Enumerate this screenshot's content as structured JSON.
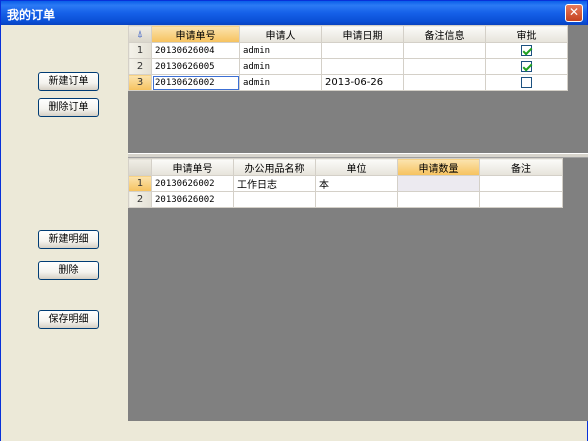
{
  "window": {
    "title": "我的订单",
    "close_symbol": "✕"
  },
  "buttons": {
    "new_order": "新建订单",
    "delete_order": "删除订单",
    "new_detail": "新建明细",
    "delete": "删除",
    "save_detail": "保存明细"
  },
  "orders": {
    "corner_symbol": "⍋",
    "columns": [
      "申请单号",
      "申请人",
      "申请日期",
      "备注信息",
      "审批"
    ],
    "rows": [
      {
        "num": "1",
        "id": "20130626004",
        "applicant": "admin",
        "date": "",
        "note": "",
        "approved": true
      },
      {
        "num": "2",
        "id": "20130626005",
        "applicant": "admin",
        "date": "",
        "note": "",
        "approved": true
      },
      {
        "num": "3",
        "id": "20130626002",
        "applicant": "admin",
        "date": "2013-06-26",
        "note": "",
        "approved": false
      }
    ]
  },
  "details": {
    "columns": [
      "申请单号",
      "办公用品名称",
      "单位",
      "申请数量",
      "备注"
    ],
    "rows": [
      {
        "num": "1",
        "id": "20130626002",
        "item": "工作日志",
        "unit": "本",
        "qty": "",
        "note": ""
      },
      {
        "num": "2",
        "id": "20130626002",
        "item": "",
        "unit": "",
        "qty": "",
        "note": ""
      }
    ]
  },
  "colors": {
    "title_bar": "#0a5fe9",
    "active_header": "#f6c25d",
    "grid_background": "#808080"
  }
}
